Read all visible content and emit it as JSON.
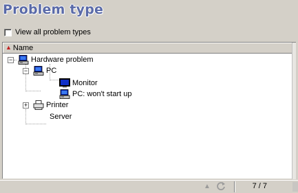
{
  "title": "Problem type",
  "view_all_label": "View all problem types",
  "column_header": "Name",
  "tree": {
    "root": "Hardware problem",
    "pc": "PC",
    "monitor": "Monitor",
    "pc_wont_start": "PC: won't start up",
    "printer": "Printer",
    "server": "Server"
  },
  "status": {
    "count": "7 / 7"
  },
  "icons": [
    "sort-ascending-icon",
    "computer-icon",
    "monitor-icon",
    "printer-icon",
    "refresh-icon",
    "up-arrow-icon"
  ]
}
